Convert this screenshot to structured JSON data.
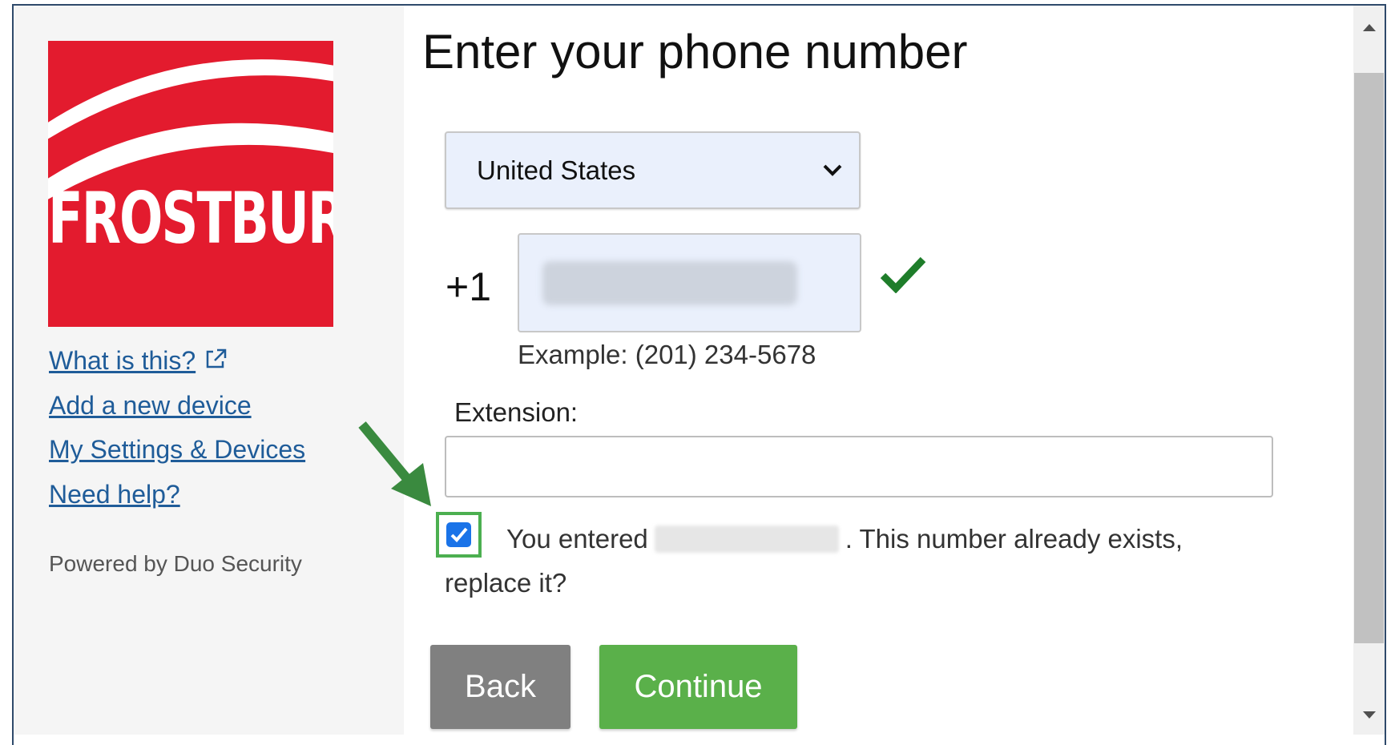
{
  "sidebar": {
    "logo_text": "FROSTBURG",
    "links": [
      {
        "label": "What is this?"
      },
      {
        "label": "Add a new device"
      },
      {
        "label": "My Settings & Devices"
      },
      {
        "label": "Need help?"
      }
    ],
    "powered_by": "Powered by Duo Security"
  },
  "main": {
    "title": "Enter your phone number",
    "country": {
      "selected": "United States"
    },
    "phone": {
      "prefix": "+1",
      "example": "Example: (201) 234-5678"
    },
    "extension": {
      "label": "Extension:",
      "value": ""
    },
    "confirm": {
      "checked": true,
      "text_before": "You entered",
      "text_after": ". This number already exists, replace it?"
    },
    "buttons": {
      "back": "Back",
      "continue": "Continue"
    }
  },
  "colors": {
    "brand_red": "#e31b2e",
    "link_blue": "#1f5c99",
    "continue_green": "#5ab04a",
    "back_gray": "#808080",
    "check_green": "#1e7d2a",
    "highlight_green": "#4caf50"
  }
}
